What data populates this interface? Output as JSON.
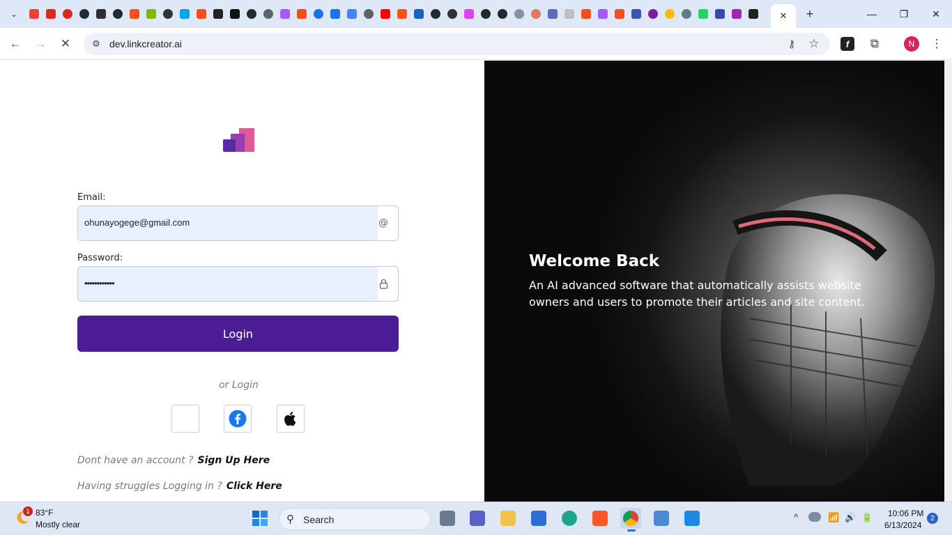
{
  "browser": {
    "tab_search_glyph": "⌄",
    "tab_favicons": [
      {
        "name": "gmail-icon",
        "color": "#ea4335"
      },
      {
        "name": "canada-leaf-icon",
        "color": "#d52b1e"
      },
      {
        "name": "canada-circle-icon",
        "color": "#d52b1e"
      },
      {
        "name": "github-icon",
        "color": "#24292e"
      },
      {
        "name": "hashnode-icon",
        "color": "#2f2f2f"
      },
      {
        "name": "github-icon",
        "color": "#24292e"
      },
      {
        "name": "microsoft-icon",
        "color": "#f25022"
      },
      {
        "name": "microsoft-icon",
        "color": "#7fba00"
      },
      {
        "name": "circle-app-icon",
        "color": "#333333"
      },
      {
        "name": "microsoft-icon",
        "color": "#00a4ef"
      },
      {
        "name": "figma-icon",
        "color": "#f24e1e"
      },
      {
        "name": "play-icon",
        "color": "#222222"
      },
      {
        "name": "x-app-icon",
        "color": "#111111"
      },
      {
        "name": "github-icon",
        "color": "#24292e"
      },
      {
        "name": "globe-icon",
        "color": "#5f6368"
      },
      {
        "name": "figma-icon",
        "color": "#a259ff"
      },
      {
        "name": "figma-icon",
        "color": "#f24e1e"
      },
      {
        "name": "loop-icon",
        "color": "#1a73e8"
      },
      {
        "name": "home-icon",
        "color": "#1a73e8"
      },
      {
        "name": "folder-icon",
        "color": "#4285f4"
      },
      {
        "name": "globe-icon",
        "color": "#5f6368"
      },
      {
        "name": "youtube-icon",
        "color": "#ff0000"
      },
      {
        "name": "orange-app-icon",
        "color": "#f4511e"
      },
      {
        "name": "flag-icon",
        "color": "#1565c0"
      },
      {
        "name": "github-icon",
        "color": "#24292e"
      },
      {
        "name": "openai-icon",
        "color": "#333333"
      },
      {
        "name": "react-icon",
        "color": "#d946ef"
      },
      {
        "name": "github-icon",
        "color": "#24292e"
      },
      {
        "name": "github-icon",
        "color": "#24292e"
      },
      {
        "name": "copilot-icon",
        "color": "#8a8fa8"
      },
      {
        "name": "claude-icon",
        "color": "#e07a5f"
      },
      {
        "name": "api-icon",
        "color": "#5c6bc0"
      },
      {
        "name": "blank-page-icon",
        "color": "#c0c0c0"
      },
      {
        "name": "figma-icon",
        "color": "#f24e1e"
      },
      {
        "name": "figma-icon",
        "color": "#a259ff"
      },
      {
        "name": "figma-icon",
        "color": "#f24e1e"
      },
      {
        "name": "printer-icon",
        "color": "#3f51b5"
      },
      {
        "name": "info-circle-icon",
        "color": "#7b1fa2"
      },
      {
        "name": "colorful-circle-icon",
        "color": "#fbbc05"
      },
      {
        "name": "settings-circle-icon",
        "color": "#607d8b"
      },
      {
        "name": "whatsapp-icon",
        "color": "#25d366"
      },
      {
        "name": "list-icon",
        "color": "#3949ab"
      },
      {
        "name": "linkcreator-icon",
        "color": "#9c27b0"
      },
      {
        "name": "grid-icon",
        "color": "#222222"
      }
    ],
    "active_tab_close": "✕",
    "new_tab": "+",
    "window_controls": {
      "minimize": "—",
      "maximize": "❐",
      "close": "✕"
    },
    "nav": {
      "back": "←",
      "forward": "→",
      "stop": "✕"
    },
    "omnibox": {
      "tune": "⚙",
      "url": "dev.linkcreator.ai",
      "key": "⚷",
      "star": "☆"
    },
    "extensions": {
      "font_ext": "f",
      "puzzle": "⧉",
      "menu": "⋮"
    },
    "profile_initial": "N"
  },
  "login": {
    "email_label": "Email:",
    "email_value": "ohunayogege@gmail.com",
    "email_icon": "@",
    "password_label": "Password:",
    "password_value": "••••••••••••",
    "password_icon": "🔒",
    "login_button": "Login",
    "or_login": "or Login",
    "signup_prompt": "Dont have an account ?",
    "signup_link": "Sign Up Here",
    "help_prompt": "Having struggles Logging in ?",
    "help_link": "Click Here",
    "brand_colors": {
      "primary": "#4c1c94",
      "logo_pink": "#e05a9a",
      "logo_purple": "#6b2fb3"
    }
  },
  "hero": {
    "title": "Welcome Back",
    "text": "An AI advanced software that automatically assists website owners and users to promote their articles and site content."
  },
  "taskbar": {
    "weather_temp": "83°F",
    "weather_desc": "Mostly clear",
    "weather_badge": "1",
    "search_label": "Search",
    "search_glyph": "⚲",
    "tray_chevron": "^",
    "tray_wifi": "📶",
    "tray_volume": "🔊",
    "tray_battery": "🔋",
    "time": "10:06 PM",
    "date": "6/13/2024",
    "notifications": "2"
  }
}
